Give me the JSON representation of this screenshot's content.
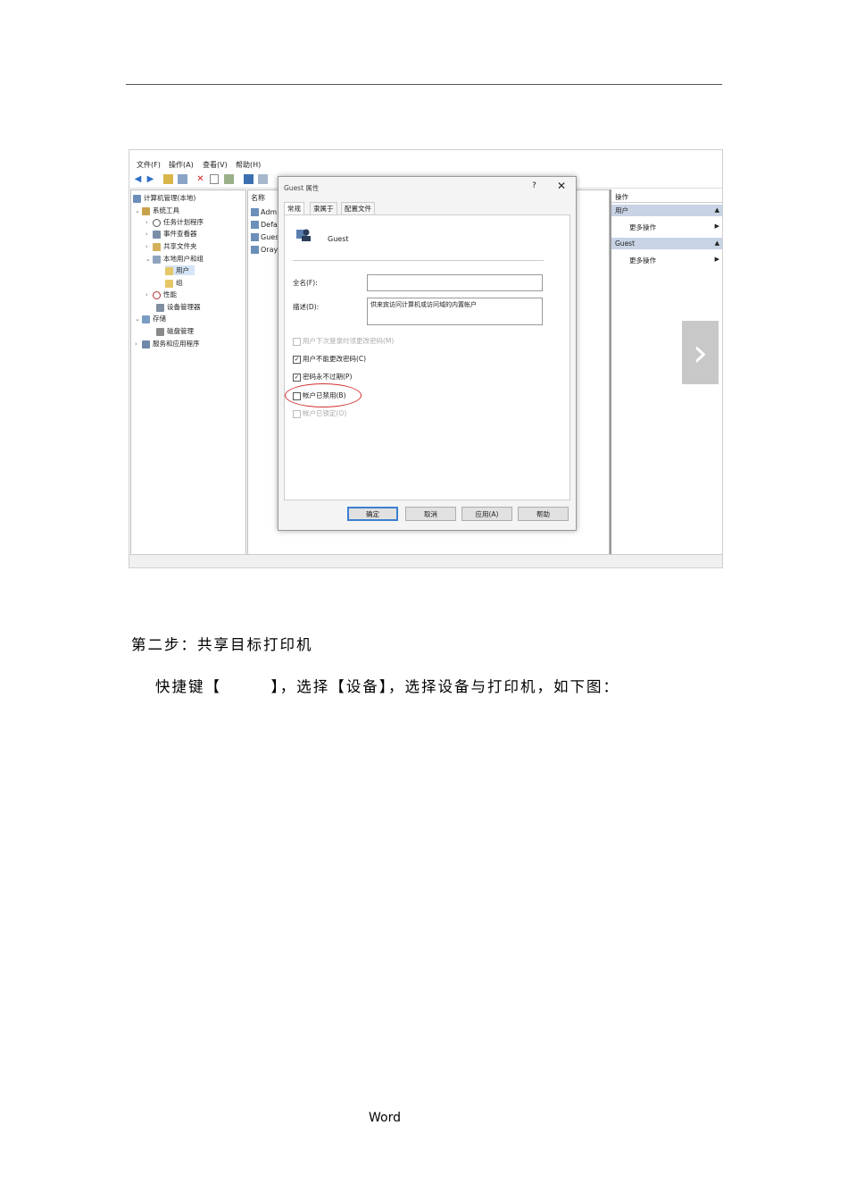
{
  "screenshot": {
    "menu": [
      "文件(F)",
      "操作(A)",
      "查看(V)",
      "帮助(H)"
    ],
    "tree": [
      {
        "label": "计算机管理(本地)",
        "icon": "computer-management-icon"
      },
      {
        "label": "系统工具",
        "icon": "tools-icon"
      },
      {
        "label": "任务计划程序",
        "icon": "clock-icon"
      },
      {
        "label": "事件查看器",
        "icon": "event-viewer-icon"
      },
      {
        "label": "共享文件夹",
        "icon": "shared-folder-icon"
      },
      {
        "label": "本地用户和组",
        "icon": "users-icon"
      },
      {
        "label": "用户",
        "icon": "folder-icon"
      },
      {
        "label": "组",
        "icon": "folder-icon"
      },
      {
        "label": "性能",
        "icon": "performance-icon"
      },
      {
        "label": "设备管理器",
        "icon": "device-manager-icon"
      },
      {
        "label": "存储",
        "icon": "storage-icon"
      },
      {
        "label": "磁盘管理",
        "icon": "disk-icon"
      },
      {
        "label": "服务和应用程序",
        "icon": "services-icon"
      }
    ],
    "list": {
      "header": "名称",
      "rows": [
        "Admi",
        "Defa",
        "Gues",
        "Oray"
      ]
    },
    "actions": {
      "header": "操作",
      "section1": "用户",
      "item1": "更多操作",
      "section2": "Guest",
      "item2": "更多操作"
    },
    "dialog": {
      "title": "Guest 属性",
      "help": "?",
      "close": "✕",
      "tabs": [
        "常规",
        "隶属于",
        "配置文件"
      ],
      "username": "Guest",
      "fullname_label": "全名(F):",
      "fullname_value": "",
      "description_label": "描述(D):",
      "description_value": "供来宾访问计算机或访问域的内置帐户",
      "checkboxes": [
        {
          "label": "用户下次登录时须更改密码(M)",
          "checked": false,
          "enabled": false
        },
        {
          "label": "用户不能更改密码(C)",
          "checked": true,
          "enabled": true
        },
        {
          "label": "密码永不过期(P)",
          "checked": true,
          "enabled": true
        },
        {
          "label": "帐户已禁用(B)",
          "checked": false,
          "enabled": true
        },
        {
          "label": "帐户已锁定(O)",
          "checked": false,
          "enabled": false
        }
      ],
      "buttons": [
        "确定",
        "取消",
        "应用(A)",
        "帮助"
      ]
    }
  },
  "next_arrow": "›",
  "step2_heading": "第二步：共享目标打印机",
  "shortcut_text": "快捷键【　　　】，选择【设备】，选择设备与打印机，如下图：",
  "footer": "Word",
  "colors": {
    "accent": "#3c7fd1",
    "highlight_circle": "#d23030",
    "action_header": "#c8d3e6"
  }
}
